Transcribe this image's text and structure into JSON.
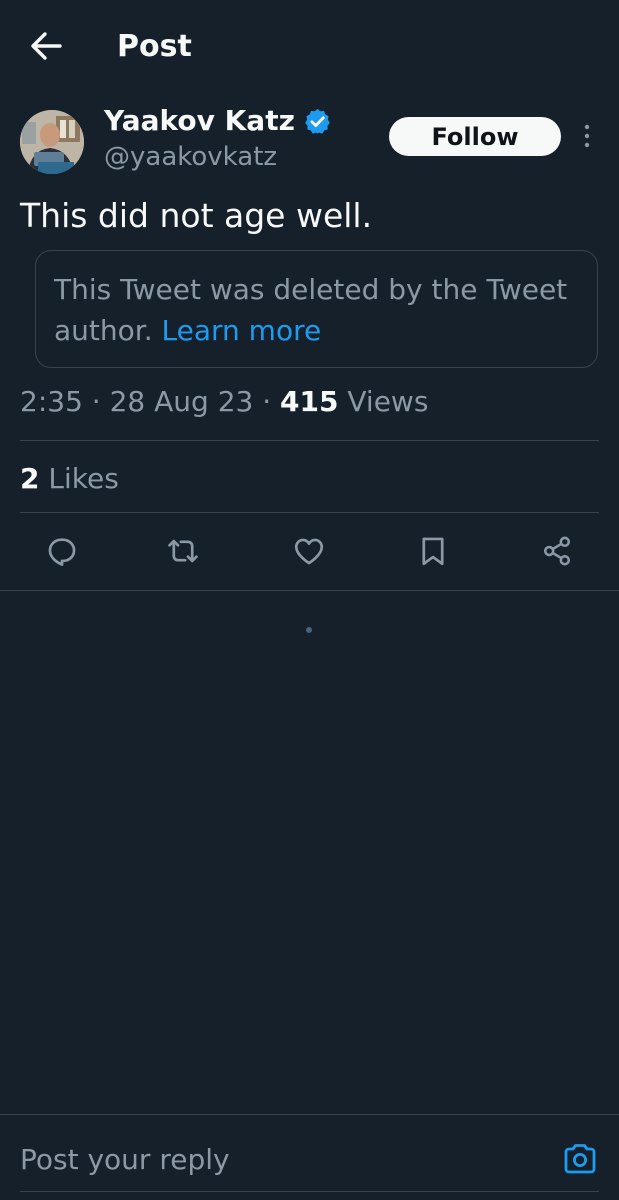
{
  "header": {
    "title": "Post",
    "back_icon": "arrow-left-icon"
  },
  "author": {
    "name": "Yaakov Katz",
    "handle": "@yaakovkatz",
    "verified_icon": "verified-badge-icon",
    "follow_label": "Follow",
    "more_icon": "more-vertical-icon"
  },
  "tweet": {
    "text": "This did not age well.",
    "quoted_deleted_text": "This Tweet was deleted by the Tweet author.",
    "learn_more_label": "Learn more"
  },
  "meta": {
    "time": "2:35",
    "date": "28 Aug 23",
    "views_count": "415",
    "views_label": "Views"
  },
  "engagement": {
    "likes_count": "2",
    "likes_label": "Likes"
  },
  "actions": [
    {
      "name": "reply",
      "icon": "reply-icon"
    },
    {
      "name": "repost",
      "icon": "repost-icon"
    },
    {
      "name": "like",
      "icon": "heart-icon"
    },
    {
      "name": "bookmark",
      "icon": "bookmark-icon"
    },
    {
      "name": "share",
      "icon": "share-icon"
    }
  ],
  "reply": {
    "placeholder": "Post your reply",
    "camera_icon": "camera-icon"
  },
  "colors": {
    "background": "#15202b",
    "text_primary": "#f7f9f9",
    "text_secondary": "#8b98a5",
    "accent": "#1d9bf0",
    "border": "#38444d"
  }
}
